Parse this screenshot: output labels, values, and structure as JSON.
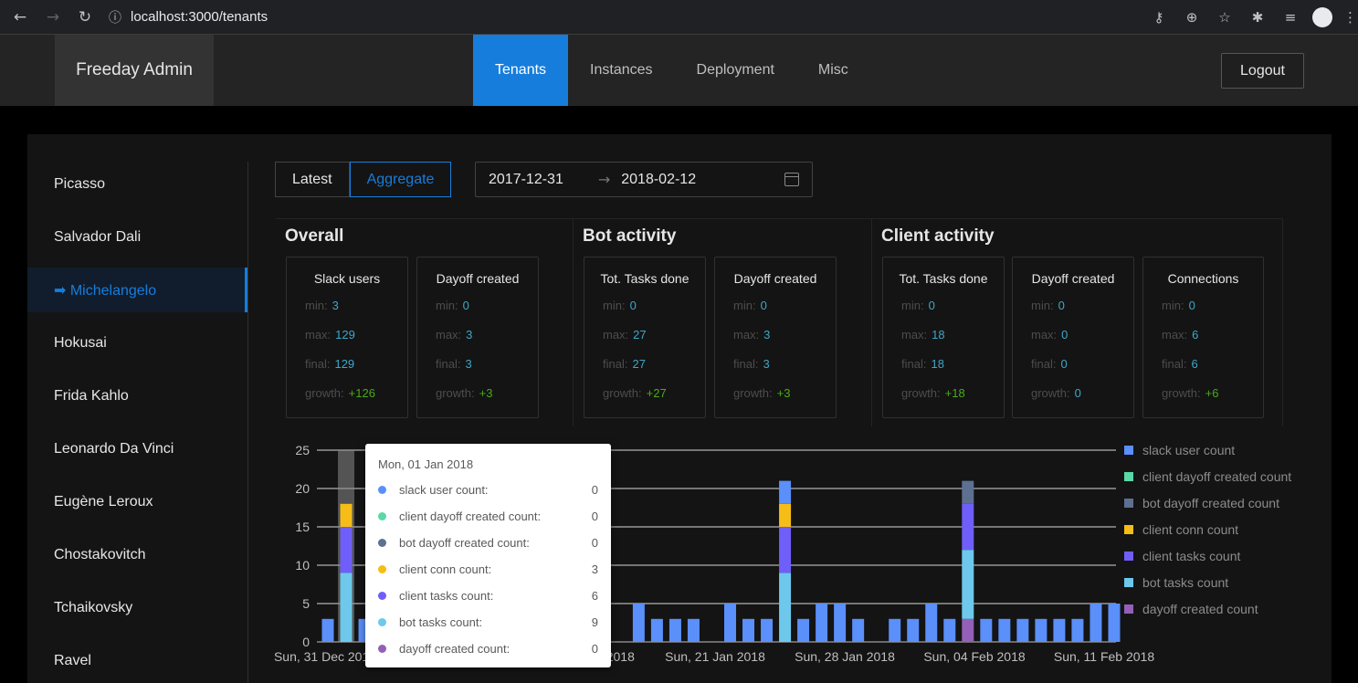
{
  "browser": {
    "url": "localhost:3000/tenants",
    "icons": [
      "back-icon",
      "forward-icon",
      "reload-icon",
      "info-icon",
      "key-icon",
      "zoom-icon",
      "star-icon",
      "extensions-icon",
      "media-icon",
      "profile-icon",
      "menu-icon"
    ]
  },
  "header": {
    "brand": "Freeday Admin",
    "menu": [
      "Tenants",
      "Instances",
      "Deployment",
      "Misc"
    ],
    "active_menu": "Tenants",
    "logout": "Logout"
  },
  "sidebar": {
    "items": [
      "Picasso",
      "Salvador Dali",
      "➡ Michelangelo",
      "Hokusai",
      "Frida Kahlo",
      "Leonardo Da Vinci",
      "Eugène Leroux",
      "Chostakovitch",
      "Tchaikovsky",
      "Ravel"
    ],
    "active_index": 2
  },
  "controls": {
    "latest": "Latest",
    "aggregate": "Aggregate",
    "active": "Aggregate",
    "date_from": "2017-12-31",
    "date_to": "2018-02-12",
    "arrow": "→"
  },
  "groups": [
    {
      "title": "Overall",
      "stats": [
        {
          "title": "Slack users",
          "min": "3",
          "max": "129",
          "final": "129",
          "growth": "+126"
        },
        {
          "title": "Dayoff created",
          "min": "0",
          "max": "3",
          "final": "3",
          "growth": "+3"
        }
      ]
    },
    {
      "title": "Bot activity",
      "stats": [
        {
          "title": "Tot. Tasks done",
          "min": "0",
          "max": "27",
          "final": "27",
          "growth": "+27"
        },
        {
          "title": "Dayoff created",
          "min": "0",
          "max": "3",
          "final": "3",
          "growth": "+3"
        }
      ]
    },
    {
      "title": "Client activity",
      "stats": [
        {
          "title": "Tot. Tasks done",
          "min": "0",
          "max": "18",
          "final": "18",
          "growth": "+18"
        },
        {
          "title": "Dayoff created",
          "min": "0",
          "max": "0",
          "final": "0",
          "growth": "0"
        },
        {
          "title": "Connections",
          "min": "0",
          "max": "6",
          "final": "6",
          "growth": "+6"
        }
      ]
    }
  ],
  "stat_labels": {
    "min": "min:",
    "max": "max:",
    "final": "final:",
    "growth": "growth:"
  },
  "chart_data": {
    "type": "bar",
    "stacked": true,
    "ylim": [
      0,
      25
    ],
    "yticks": [
      "0",
      "5",
      "10",
      "15",
      "20",
      "25"
    ],
    "xtick_labels": [
      "Sun, 31 Dec 2017",
      "Sun, 07 Jan 2018",
      "Sun, 14 Jan 2018",
      "Sun, 21 Jan 2018",
      "Sun, 28 Jan 2018",
      "Sun, 04 Feb 2018",
      "Sun, 11 Feb 2018"
    ],
    "legend_position": "right",
    "series": [
      {
        "name": "slack user count",
        "color": "#5b8ff9"
      },
      {
        "name": "client dayoff created count",
        "color": "#5ad8a6"
      },
      {
        "name": "bot dayoff created count",
        "color": "#5d7092"
      },
      {
        "name": "client conn count",
        "color": "#f6bd16"
      },
      {
        "name": "client tasks count",
        "color": "#6f5ef9"
      },
      {
        "name": "bot tasks count",
        "color": "#6dc8ec"
      },
      {
        "name": "dayoff created count",
        "color": "#945fb9"
      }
    ],
    "days": [
      {
        "date": "Sun, 31 Dec 2017",
        "values": [
          3,
          0,
          0,
          0,
          0,
          0,
          0
        ]
      },
      {
        "date": "Mon, 01 Jan 2018",
        "values": [
          0,
          0,
          0,
          3,
          6,
          9,
          0
        ],
        "hover_bg": 7
      },
      {
        "date": "Tue, 02 Jan 2018",
        "values": [
          3,
          0,
          0,
          0,
          0,
          0,
          0
        ]
      },
      {
        "date": "Wed, 03 Jan 2018",
        "values": [
          3,
          0,
          0,
          0,
          0,
          0,
          0
        ]
      },
      {
        "date": "Thu, 04 Jan 2018",
        "values": [
          3,
          0,
          0,
          0,
          0,
          0,
          0
        ]
      },
      {
        "date": "Fri, 05 Jan 2018",
        "values": [
          3,
          0,
          0,
          0,
          0,
          0,
          0
        ]
      },
      {
        "date": "Sat, 06 Jan 2018",
        "values": [
          3,
          0,
          0,
          0,
          0,
          0,
          0
        ]
      },
      {
        "date": "Sun, 07 Jan 2018",
        "values": [
          3,
          0,
          0,
          0,
          0,
          0,
          0
        ]
      },
      {
        "date": "Mon, 08 Jan 2018",
        "values": [
          3,
          0,
          0,
          0,
          0,
          0,
          0
        ]
      },
      {
        "date": "Tue, 09 Jan 2018",
        "values": [
          3,
          0,
          0,
          0,
          0,
          0,
          0
        ]
      },
      {
        "date": "Wed, 10 Jan 2018",
        "values": [
          3,
          0,
          0,
          0,
          0,
          0,
          0
        ]
      },
      {
        "date": "Thu, 11 Jan 2018",
        "values": [
          3,
          0,
          0,
          0,
          0,
          0,
          0
        ]
      },
      {
        "date": "Fri, 12 Jan 2018",
        "values": [
          3,
          0,
          0,
          0,
          0,
          0,
          0
        ]
      },
      {
        "date": "Sat, 13 Jan 2018",
        "values": [
          5,
          0,
          0,
          0,
          0,
          0,
          0
        ]
      },
      {
        "date": "Sun, 14 Jan 2018",
        "values": [
          3,
          0,
          0,
          0,
          0,
          0,
          0
        ]
      },
      {
        "date": "Mon, 15 Jan 2018",
        "values": [
          0,
          0,
          0,
          0,
          0,
          0,
          0
        ]
      },
      {
        "date": "Tue, 16 Jan 2018",
        "values": [
          0,
          0,
          0,
          0,
          0,
          0,
          0
        ]
      },
      {
        "date": "Wed, 17 Jan 2018",
        "values": [
          5,
          0,
          0,
          0,
          0,
          0,
          0
        ]
      },
      {
        "date": "Thu, 18 Jan 2018",
        "values": [
          3,
          0,
          0,
          0,
          0,
          0,
          0
        ]
      },
      {
        "date": "Fri, 19 Jan 2018",
        "values": [
          3,
          0,
          0,
          0,
          0,
          0,
          0
        ]
      },
      {
        "date": "Sat, 20 Jan 2018",
        "values": [
          3,
          0,
          0,
          0,
          0,
          0,
          0
        ]
      },
      {
        "date": "Sun, 21 Jan 2018",
        "values": [
          0,
          0,
          0,
          0,
          0,
          0,
          0
        ]
      },
      {
        "date": "Mon, 22 Jan 2018",
        "values": [
          5,
          0,
          0,
          0,
          0,
          0,
          0
        ]
      },
      {
        "date": "Tue, 23 Jan 2018",
        "values": [
          3,
          0,
          0,
          0,
          0,
          0,
          0
        ]
      },
      {
        "date": "Wed, 24 Jan 2018",
        "values": [
          3,
          0,
          0,
          0,
          0,
          0,
          0
        ]
      },
      {
        "date": "Thu, 25 Jan 2018",
        "values": [
          0,
          0,
          0,
          3,
          6,
          9,
          0
        ],
        "extra_top": 3
      },
      {
        "date": "Fri, 26 Jan 2018",
        "values": [
          3,
          0,
          0,
          0,
          0,
          0,
          0
        ]
      },
      {
        "date": "Sat, 27 Jan 2018",
        "values": [
          5,
          0,
          0,
          0,
          0,
          0,
          0
        ]
      },
      {
        "date": "Sun, 28 Jan 2018",
        "values": [
          5,
          0,
          0,
          0,
          0,
          0,
          0
        ]
      },
      {
        "date": "Mon, 29 Jan 2018",
        "values": [
          3,
          0,
          0,
          0,
          0,
          0,
          0
        ]
      },
      {
        "date": "Tue, 30 Jan 2018",
        "values": [
          0,
          0,
          0,
          0,
          0,
          0,
          0
        ]
      },
      {
        "date": "Wed, 31 Jan 2018",
        "values": [
          3,
          0,
          0,
          0,
          0,
          0,
          0
        ]
      },
      {
        "date": "Thu, 01 Feb 2018",
        "values": [
          3,
          0,
          0,
          0,
          0,
          0,
          0
        ]
      },
      {
        "date": "Fri, 02 Feb 2018",
        "values": [
          5,
          0,
          0,
          0,
          0,
          0,
          0
        ]
      },
      {
        "date": "Sat, 03 Feb 2018",
        "values": [
          3,
          0,
          0,
          0,
          0,
          0,
          0
        ]
      },
      {
        "date": "Sun, 04 Feb 2018",
        "values": [
          0,
          0,
          3,
          0,
          6,
          9,
          3
        ]
      },
      {
        "date": "Mon, 05 Feb 2018",
        "values": [
          3,
          0,
          0,
          0,
          0,
          0,
          0
        ]
      },
      {
        "date": "Tue, 06 Feb 2018",
        "values": [
          3,
          0,
          0,
          0,
          0,
          0,
          0
        ]
      },
      {
        "date": "Wed, 07 Feb 2018",
        "values": [
          3,
          0,
          0,
          0,
          0,
          0,
          0
        ]
      },
      {
        "date": "Thu, 08 Feb 2018",
        "values": [
          3,
          0,
          0,
          0,
          0,
          0,
          0
        ]
      },
      {
        "date": "Fri, 09 Feb 2018",
        "values": [
          3,
          0,
          0,
          0,
          0,
          0,
          0
        ]
      },
      {
        "date": "Sat, 10 Feb 2018",
        "values": [
          3,
          0,
          0,
          0,
          0,
          0,
          0
        ]
      },
      {
        "date": "Sun, 11 Feb 2018",
        "values": [
          5,
          0,
          0,
          0,
          0,
          0,
          0
        ]
      },
      {
        "date": "Mon, 12 Feb 2018",
        "values": [
          5,
          0,
          0,
          0,
          0,
          0,
          0
        ]
      }
    ]
  },
  "tooltip": {
    "title": "Mon, 01 Jan 2018",
    "rows": [
      {
        "label": "slack user count:",
        "value": "0",
        "color": "#5b8ff9"
      },
      {
        "label": "client dayoff created count:",
        "value": "0",
        "color": "#5ad8a6"
      },
      {
        "label": "bot dayoff created count:",
        "value": "0",
        "color": "#5d7092"
      },
      {
        "label": "client conn count:",
        "value": "3",
        "color": "#f6bd16"
      },
      {
        "label": "client tasks count:",
        "value": "6",
        "color": "#6f5ef9"
      },
      {
        "label": "bot tasks count:",
        "value": "9",
        "color": "#6dc8ec"
      },
      {
        "label": "dayoff created count:",
        "value": "0",
        "color": "#945fb9"
      }
    ]
  }
}
